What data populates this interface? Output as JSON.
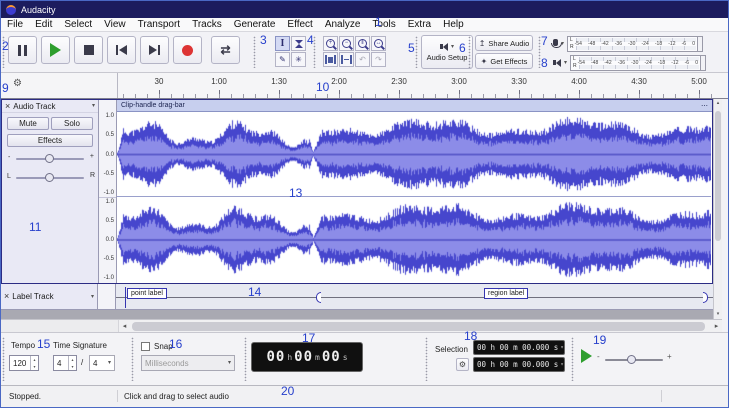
{
  "window": {
    "title": "Audacity"
  },
  "menu": {
    "items": [
      "File",
      "Edit",
      "Select",
      "View",
      "Transport",
      "Tracks",
      "Generate",
      "Effect",
      "Analyze",
      "Tools",
      "Extra",
      "Help"
    ]
  },
  "toolbar": {
    "audio_setup": "Audio Setup",
    "share_audio": "Share Audio",
    "get_effects": "Get Effects"
  },
  "meter": {
    "scale": [
      "-54",
      "-48",
      "-42",
      "-36",
      "-30",
      "-24",
      "-18",
      "-12",
      "-6",
      "0"
    ],
    "left": "L",
    "right": "R"
  },
  "timeline": {
    "labels": [
      "30",
      "1:00",
      "1:30",
      "2:00",
      "2:30",
      "3:00",
      "3:30",
      "4:00",
      "4:30",
      "5:00"
    ]
  },
  "track": {
    "title": "Audio Track",
    "mute": "Mute",
    "solo": "Solo",
    "effects": "Effects",
    "gain_min": "-",
    "gain_max": "+",
    "pan_left": "L",
    "pan_right": "R",
    "clip_title": "Clip-handle drag-bar",
    "scale": [
      "1.0",
      "0.5",
      "0.0",
      "-0.5",
      "-1.0"
    ]
  },
  "label_track": {
    "title": "Label Track",
    "point_label": "point label",
    "region_label": "region label"
  },
  "bottom": {
    "tempo_label": "Tempo",
    "tempo_value": "120",
    "time_sig_label": "Time Signature",
    "time_sig_upper": "4",
    "time_sig_slash": "/",
    "time_sig_lower": "4",
    "snap_label": "Snap",
    "snap_value": "Milliseconds",
    "time_h": "00",
    "time_m": "00",
    "time_s": "00",
    "unit_h": "h",
    "unit_m": "m",
    "unit_s": "s",
    "selection_label": "Selection",
    "selection_start": "00 h 00 m 00.000 s",
    "selection_end": "00 h 00 m 00.000 s"
  },
  "status": {
    "state": "Stopped.",
    "message": "Click and drag to select audio"
  },
  "icons": {
    "close": "×",
    "chevron_down": "▾",
    "caret_down": "▾",
    "menu_dots": "⋯",
    "gear": "⚙",
    "loop": "⇄",
    "selection_tool": "I",
    "draw_tool": "✎",
    "multi_tool": "✳",
    "zoom_in": "+",
    "zoom_out": "−",
    "zoom_sel": "‖",
    "zoom_fit": "↔",
    "undo": "↶",
    "redo": "↷",
    "share": "↥",
    "sparkle": "✦",
    "scroll_left": "◂",
    "scroll_right": "▸",
    "scroll_up": "▴",
    "scroll_down": "▾",
    "spin_up": "▴",
    "spin_down": "▾",
    "slider_minus": "-",
    "slider_plus": "+"
  },
  "annotations": [
    "1",
    "2",
    "3",
    "4",
    "5",
    "6",
    "7",
    "8",
    "9",
    "10",
    "11",
    "13",
    "14",
    "15",
    "16",
    "17",
    "18",
    "19",
    "20"
  ]
}
